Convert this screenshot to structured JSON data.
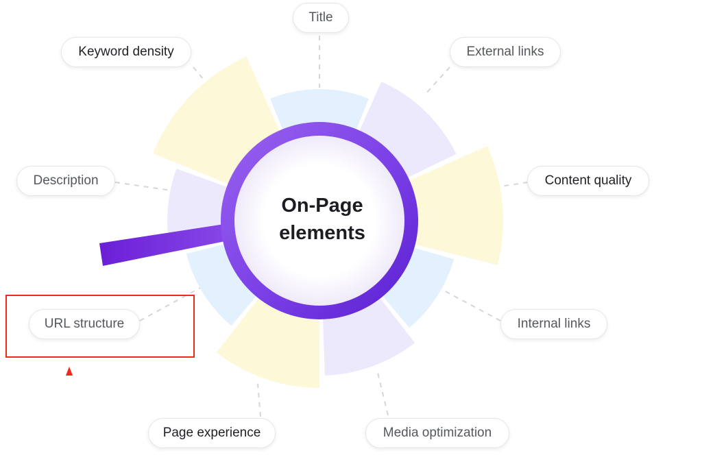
{
  "center": {
    "line1": "On-Page",
    "line2": "elements"
  },
  "labels": {
    "title": "Title",
    "keyword_density": "Keyword density",
    "external_links": "External links",
    "description": "Description",
    "content_quality": "Content quality",
    "url_structure": "URL structure",
    "internal_links": "Internal links",
    "page_experience": "Page experience",
    "media_optimization": "Media optimization"
  },
  "colors": {
    "segment_blue": "#e3f0fd",
    "segment_purple": "#ece9fc",
    "segment_yellow": "#fcf8d8",
    "ring": "#7b3fe4",
    "handle": "#7a2ee0",
    "annotation": "#f2281e"
  },
  "annotation": {
    "target": "url_structure",
    "marker": "red-box-with-arrow"
  }
}
